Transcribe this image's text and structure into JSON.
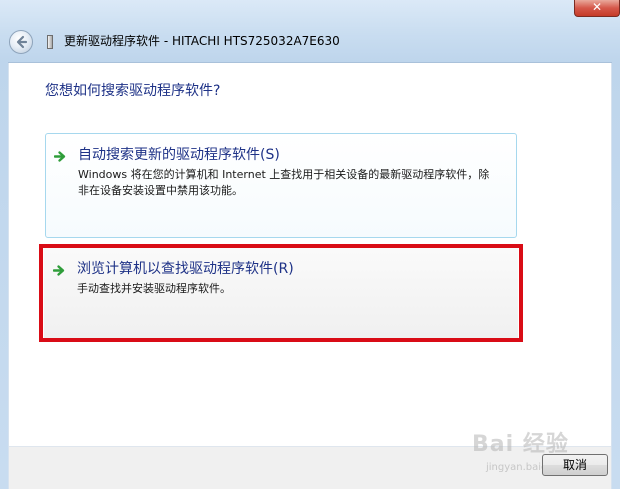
{
  "window": {
    "title": "更新驱动程序软件 - HITACHI HTS725032A7E630",
    "close_label": "✕"
  },
  "main": {
    "question": "您想如何搜索驱动程序软件?",
    "options": [
      {
        "title": "自动搜索更新的驱动程序软件(S)",
        "description": "Windows 将在您的计算机和 Internet 上查找用于相关设备的最新驱动程序软件，除非在设备安装设置中禁用该功能。",
        "highlighted": false
      },
      {
        "title": "浏览计算机以查找驱动程序软件(R)",
        "description": "手动查找并安装驱动程序软件。",
        "highlighted": true
      }
    ]
  },
  "footer": {
    "cancel_label": "取消"
  },
  "watermark": {
    "logo": "Bai 经验",
    "url": "jingyan.baidu.com"
  },
  "colors": {
    "link_blue": "#1e3287",
    "arrow_green": "#2f9d3a",
    "highlight_red": "#d90c16",
    "chrome_blue": "#c9ddf0"
  },
  "icons": {
    "back": "back-arrow-icon",
    "option_arrow": "green-arrow-icon",
    "title_icon": "device-icon"
  }
}
